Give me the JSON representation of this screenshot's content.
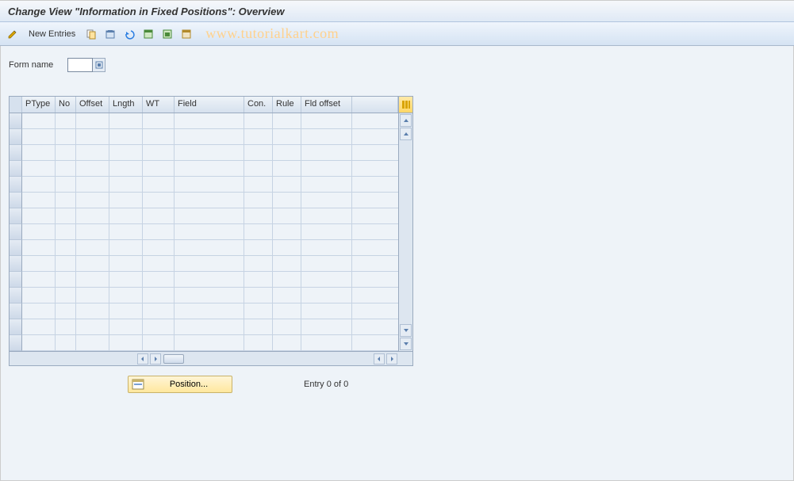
{
  "title": "Change View \"Information in Fixed Positions\": Overview",
  "toolbar": {
    "new_entries_label": "New Entries"
  },
  "watermark": "www.tutorialkart.com",
  "form": {
    "name_label": "Form name",
    "name_value": ""
  },
  "table": {
    "columns": {
      "ptype": "PType",
      "no": "No",
      "offset": "Offset",
      "lngth": "Lngth",
      "wt": "WT",
      "field": "Field",
      "con": "Con.",
      "rule": "Rule",
      "fldoffset": "Fld offset"
    },
    "rows": [
      {
        "ptype": "",
        "no": "",
        "offset": "",
        "lngth": "",
        "wt": "",
        "field": "",
        "con": "",
        "rule": "",
        "fldoffset": ""
      },
      {
        "ptype": "",
        "no": "",
        "offset": "",
        "lngth": "",
        "wt": "",
        "field": "",
        "con": "",
        "rule": "",
        "fldoffset": ""
      },
      {
        "ptype": "",
        "no": "",
        "offset": "",
        "lngth": "",
        "wt": "",
        "field": "",
        "con": "",
        "rule": "",
        "fldoffset": ""
      },
      {
        "ptype": "",
        "no": "",
        "offset": "",
        "lngth": "",
        "wt": "",
        "field": "",
        "con": "",
        "rule": "",
        "fldoffset": ""
      },
      {
        "ptype": "",
        "no": "",
        "offset": "",
        "lngth": "",
        "wt": "",
        "field": "",
        "con": "",
        "rule": "",
        "fldoffset": ""
      },
      {
        "ptype": "",
        "no": "",
        "offset": "",
        "lngth": "",
        "wt": "",
        "field": "",
        "con": "",
        "rule": "",
        "fldoffset": ""
      },
      {
        "ptype": "",
        "no": "",
        "offset": "",
        "lngth": "",
        "wt": "",
        "field": "",
        "con": "",
        "rule": "",
        "fldoffset": ""
      },
      {
        "ptype": "",
        "no": "",
        "offset": "",
        "lngth": "",
        "wt": "",
        "field": "",
        "con": "",
        "rule": "",
        "fldoffset": ""
      },
      {
        "ptype": "",
        "no": "",
        "offset": "",
        "lngth": "",
        "wt": "",
        "field": "",
        "con": "",
        "rule": "",
        "fldoffset": ""
      },
      {
        "ptype": "",
        "no": "",
        "offset": "",
        "lngth": "",
        "wt": "",
        "field": "",
        "con": "",
        "rule": "",
        "fldoffset": ""
      },
      {
        "ptype": "",
        "no": "",
        "offset": "",
        "lngth": "",
        "wt": "",
        "field": "",
        "con": "",
        "rule": "",
        "fldoffset": ""
      },
      {
        "ptype": "",
        "no": "",
        "offset": "",
        "lngth": "",
        "wt": "",
        "field": "",
        "con": "",
        "rule": "",
        "fldoffset": ""
      },
      {
        "ptype": "",
        "no": "",
        "offset": "",
        "lngth": "",
        "wt": "",
        "field": "",
        "con": "",
        "rule": "",
        "fldoffset": ""
      },
      {
        "ptype": "",
        "no": "",
        "offset": "",
        "lngth": "",
        "wt": "",
        "field": "",
        "con": "",
        "rule": "",
        "fldoffset": ""
      },
      {
        "ptype": "",
        "no": "",
        "offset": "",
        "lngth": "",
        "wt": "",
        "field": "",
        "con": "",
        "rule": "",
        "fldoffset": ""
      }
    ]
  },
  "footer": {
    "position_label": "Position...",
    "entry_text": "Entry 0 of 0"
  }
}
